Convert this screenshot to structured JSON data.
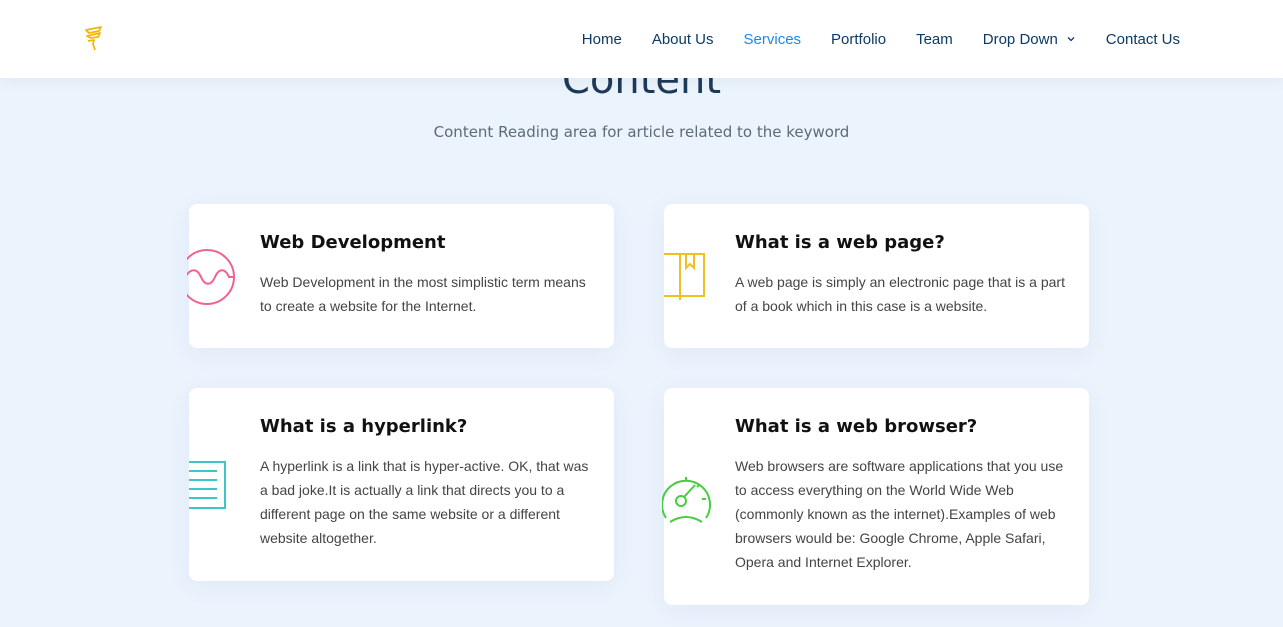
{
  "nav": {
    "items": [
      {
        "label": "Home",
        "active": false
      },
      {
        "label": "About Us",
        "active": false
      },
      {
        "label": "Services",
        "active": true
      },
      {
        "label": "Portfolio",
        "active": false
      },
      {
        "label": "Team",
        "active": false
      },
      {
        "label": "Drop Down",
        "active": false
      },
      {
        "label": "Contact Us",
        "active": false
      }
    ]
  },
  "section": {
    "title": "Content",
    "subtitle": "Content Reading area for article related to the keyword"
  },
  "cards": [
    {
      "icon": "activity-wave-icon",
      "color": "#f06292",
      "title": "Web Development",
      "text": "Web Development in the most simplistic term means to create a website for the Internet."
    },
    {
      "icon": "book-bookmark-icon",
      "color": "#f0c020",
      "title": "What is a web page?",
      "text": "A web page is simply an electronic page that is a part of a book which in this case is a website."
    },
    {
      "icon": "document-lines-icon",
      "color": "#3ec6c4",
      "title": "What is a hyperlink?",
      "text": "A hyperlink is a link that is hyper-active. OK, that was a bad joke.It is actually a link that directs you to a different page on the same website or a different website altogether."
    },
    {
      "icon": "speedometer-icon",
      "color": "#47cc42",
      "title": "What is a web browser?",
      "text": "Web browsers are software applications that you use to access everything on the World Wide Web (commonly known as the internet).Examples of web browsers would be: Google Chrome, Apple Safari, Opera and Internet Explorer."
    }
  ],
  "colors": {
    "nav_text": "#0b3a66",
    "nav_active": "#1e88e5",
    "logo": "#f2b705",
    "background": "#ebf3fd"
  }
}
